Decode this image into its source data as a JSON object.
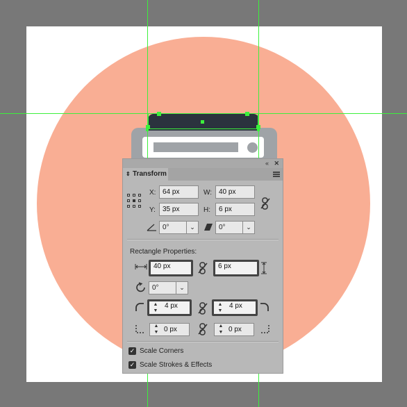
{
  "panel": {
    "tab_title": "Transform",
    "collapse_glyph": "«",
    "close_glyph": "✕",
    "x_label": "X:",
    "x_value": "64 px",
    "y_label": "Y:",
    "y_value": "35 px",
    "w_label": "W:",
    "w_value": "40 px",
    "h_label": "H:",
    "h_value": "6 px",
    "angle_value": "0°",
    "shear_value": "0°",
    "rect_props_label": "Rectangle Properties:",
    "rect_width": "40 px",
    "rect_height": "6 px",
    "rect_rotation": "0°",
    "corner_tl": "4 px",
    "corner_tr": "4 px",
    "corner_bl": "0 px",
    "corner_br": "0 px",
    "scale_corners_label": "Scale Corners",
    "scale_strokes_label": "Scale Strokes & Effects",
    "scale_corners_checked": true,
    "scale_strokes_checked": true
  },
  "colors": {
    "canvas_bg": "#787878",
    "artboard": "#ffffff",
    "circle": "#f9ae94",
    "guide": "#3cf03c",
    "dark_rect": "#2b333e",
    "device_gray": "#9fa3a7"
  },
  "icons": [
    "reference-point-icon",
    "link-icon",
    "angle-icon",
    "shear-icon",
    "width-icon",
    "height-icon",
    "rotate-icon",
    "corner-icon",
    "checkbox-icon",
    "panel-menu-icon"
  ]
}
